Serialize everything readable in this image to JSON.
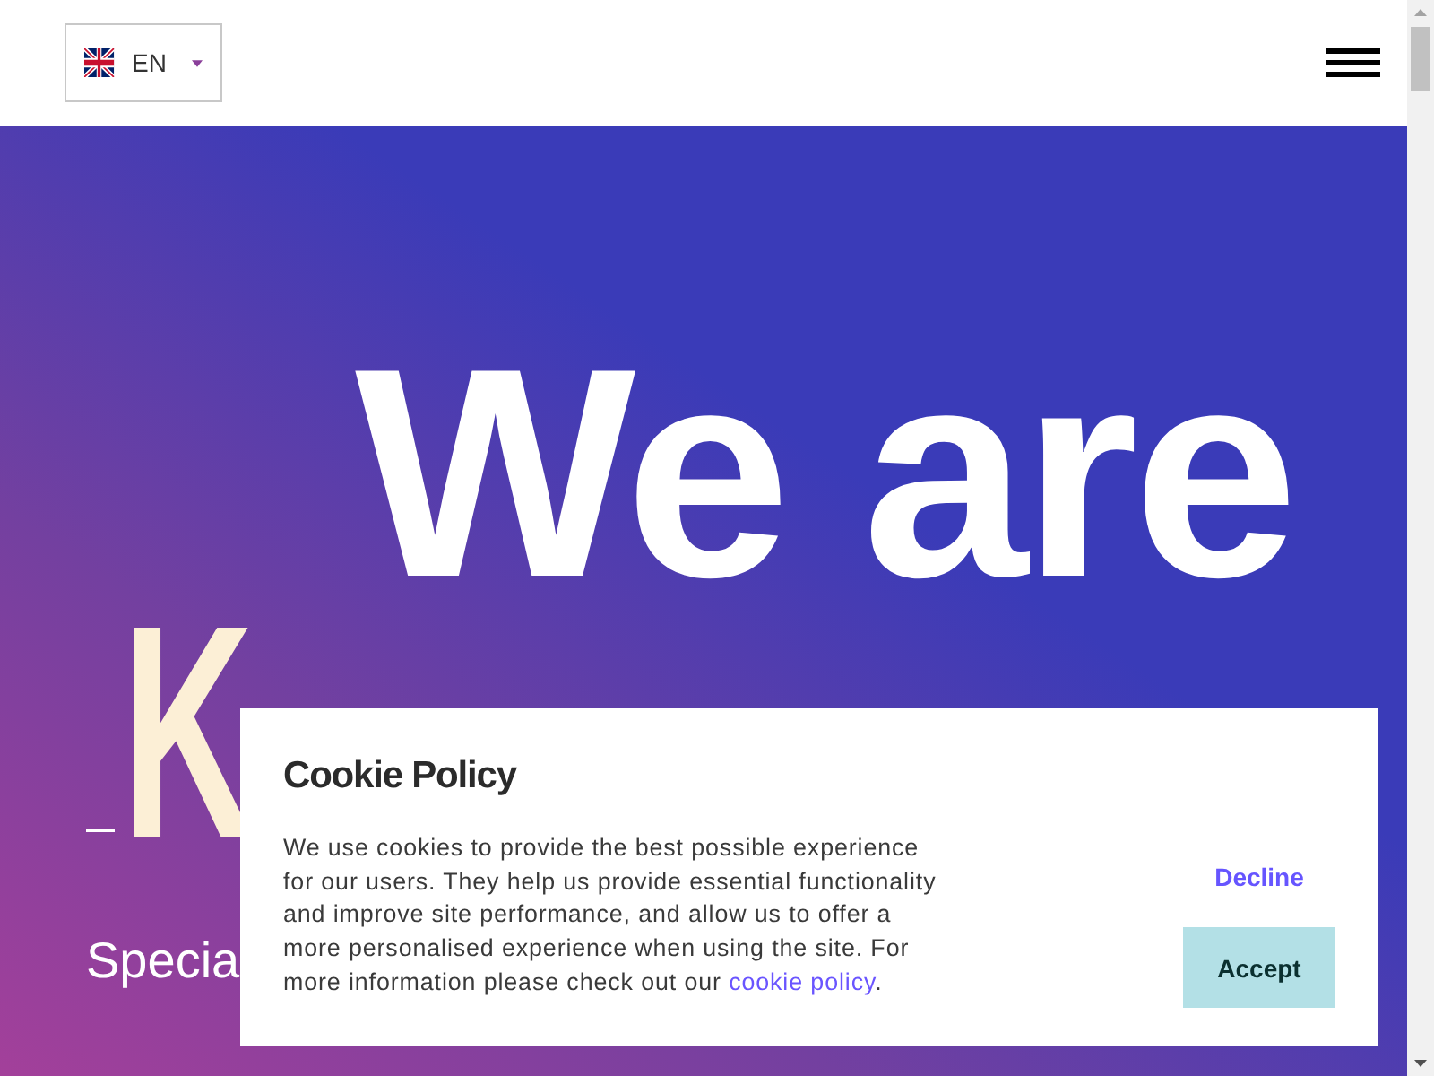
{
  "header": {
    "language": {
      "code": "EN"
    }
  },
  "hero": {
    "headline": "We are",
    "name_partial": "K",
    "subtitle_partial": "Specia"
  },
  "cookie_banner": {
    "title": "Cookie Policy",
    "body": "We use cookies to provide the best possible experience for our users. They help us provide essential functionality and improve site performance, and allow us to offer a more personalised experience when using the site. For more information please check out our ",
    "link": "cookie policy",
    "body_end": ".",
    "buttons": [
      {
        "label": "Decline",
        "kind": "link"
      },
      {
        "label": "Accept",
        "kind": "primary"
      }
    ]
  }
}
